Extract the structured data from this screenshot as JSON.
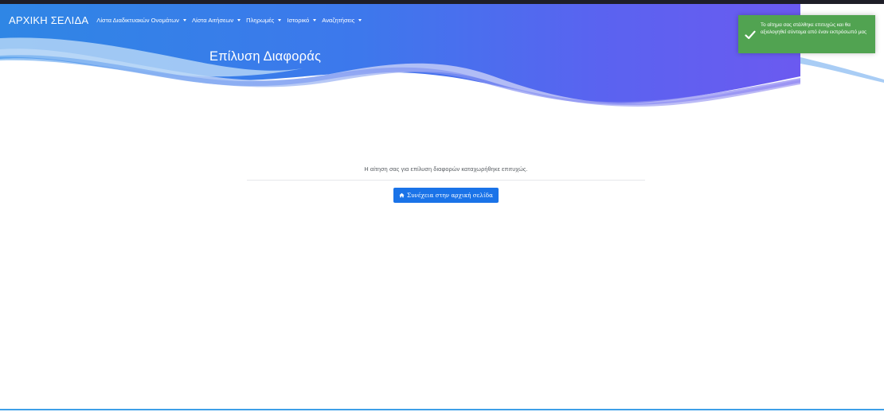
{
  "navbar": {
    "brand": "ΑΡΧΙΚΗ ΣΕΛΙΔΑ",
    "items": [
      {
        "label": "Λίστα Διαδικτυακών Ονομάτων"
      },
      {
        "label": "Λίστα Αιτήσεων"
      },
      {
        "label": "Πληρωμές"
      },
      {
        "label": "Ιστορικό"
      },
      {
        "label": "Αναζητήσεις"
      }
    ]
  },
  "page": {
    "title": "Επίλυση Διαφοράς"
  },
  "toast": {
    "message": "Το αίτημα σας στάλθηκε επιτυχώς και θα αξιολογηθεί σύντομα από έναν εκπρόσωπό μας",
    "icon": "checkmark-icon",
    "color": "#51a351"
  },
  "main": {
    "message": "Η αίτηση σας για επίλυση διαφορών καταχωρήθηκε επιτυχώς.",
    "continue_button": "Συνέχεια στην αρχική σελίδα",
    "continue_icon": "home-icon"
  },
  "colors": {
    "primary_button": "#1a73e8",
    "header_gradient_start": "#3b8fe8",
    "header_gradient_end": "#7b5cf0"
  }
}
